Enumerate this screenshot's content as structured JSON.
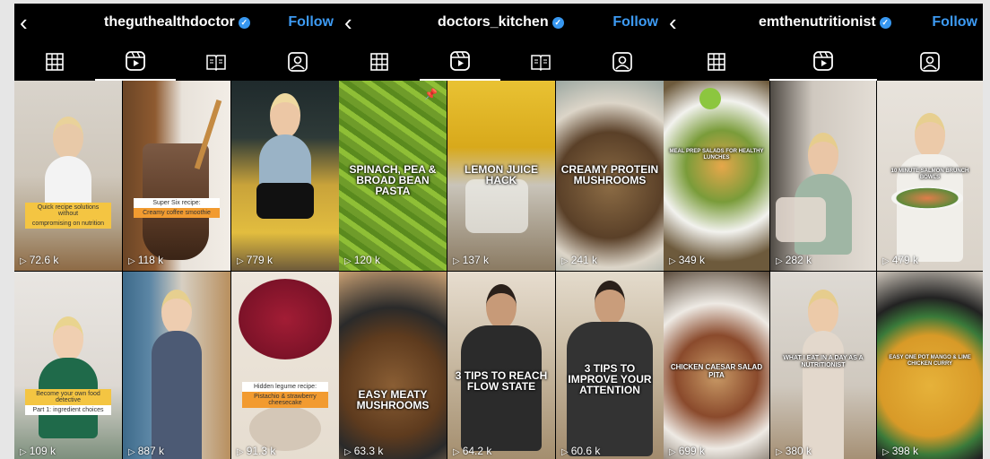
{
  "panels": [
    {
      "username": "theguthealthdoctor",
      "follow": "Follow",
      "tiles": [
        {
          "views": "72.6 k",
          "sticker": [
            "Quick recipe solutions without",
            "compromising on nutrition"
          ]
        },
        {
          "views": "118 k",
          "sticker": [
            "Super Six recipe:",
            "Creamy coffee smoothie"
          ]
        },
        {
          "views": "779 k"
        },
        {
          "views": "109 k",
          "sticker": [
            "Become your own food detective",
            "Part 1: ingredient choices"
          ]
        },
        {
          "views": "887 k"
        },
        {
          "views": "91.3 k",
          "sticker": [
            "Hidden legume recipe:",
            "Pistachio & strawberry cheesecake"
          ]
        }
      ]
    },
    {
      "username": "doctors_kitchen",
      "follow": "Follow",
      "tiles": [
        {
          "views": "120 k",
          "caption": "SPINACH, PEA & BROAD BEAN PASTA",
          "pinned": true
        },
        {
          "views": "137 k",
          "caption": "LEMON JUICE HACK"
        },
        {
          "views": "241 k",
          "caption": "CREAMY PROTEIN MUSHROOMS"
        },
        {
          "views": "63.3 k",
          "caption": "EASY MEATY MUSHROOMS"
        },
        {
          "views": "64.2 k",
          "caption": "3 TIPS TO REACH FLOW STATE"
        },
        {
          "views": "60.6 k",
          "caption": "3 TIPS TO IMPROVE YOUR ATTENTION"
        }
      ]
    },
    {
      "username": "emthenutritionist",
      "follow": "Follow",
      "tiles": [
        {
          "views": "349 k",
          "caption": "MEAL PREP SALADS FOR HEALTHY LUNCHES"
        },
        {
          "views": "282 k"
        },
        {
          "views": "479 k",
          "caption": "10 MINUTE SALMON BRUNCH BOWLS"
        },
        {
          "views": "699 k",
          "caption": "CHICKEN CAESAR SALAD PITA"
        },
        {
          "views": "380 k",
          "caption": "WHAT I EAT IN A DAY AS A NUTRITIONIST"
        },
        {
          "views": "398 k",
          "caption": "EASY ONE POT MANGO & LIME CHICKEN CURRY"
        }
      ]
    }
  ],
  "icons": {
    "back": "chevron-left-icon",
    "grid": "grid-icon",
    "reels": "reels-icon",
    "guides": "guides-icon",
    "tagged": "tagged-icon"
  },
  "colors": {
    "follow": "#3d9af2",
    "verified": "#3797f0",
    "bar": "#000000"
  }
}
